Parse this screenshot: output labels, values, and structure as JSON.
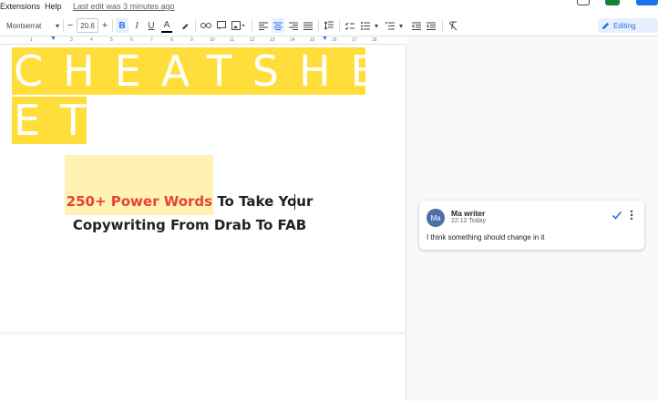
{
  "menubar": {
    "extensions": "Extensions",
    "help": "Help",
    "last_edit": "Last edit was 3 minutes ago"
  },
  "toolbar": {
    "font": "Montserrat",
    "font_size": "20.6",
    "bold": "B",
    "italic": "I",
    "underline": "U",
    "text_color": "A",
    "mode": "Editing"
  },
  "ruler": {
    "ticks": [
      "1",
      "2",
      "3",
      "4",
      "5",
      "6",
      "7",
      "8",
      "9",
      "10",
      "11",
      "12",
      "13",
      "14",
      "15",
      "16",
      "17",
      "18"
    ]
  },
  "document": {
    "title_line1": "CHEATSHE",
    "title_line2": "ET",
    "headline_red": "250+ Power Words",
    "headline_rest1": " To Take Your",
    "headline_line2": "Copywriting From Drab To FAB"
  },
  "comment": {
    "initials": "Ma",
    "author": "Ma writer",
    "time": "22:12 Today",
    "text": "I think something should change in it"
  },
  "colors": {
    "title_highlight": "#ffde3b",
    "headline_red": "#ea4335",
    "accent": "#1a73e8"
  }
}
